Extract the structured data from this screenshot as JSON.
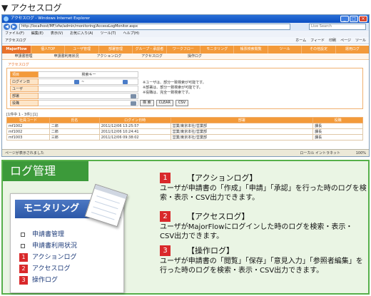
{
  "heading": "▼ アクセスログ",
  "browser": {
    "title": "アクセスログ - Windows Internet Explorer",
    "url": "http://localhost/MF/vfw/admin/monitoring/AccessLogMonitor.aspx",
    "search_placeholder": "Live Search",
    "menu": [
      "ファイル(F)",
      "編集(E)",
      "表示(V)",
      "お気に入り(A)",
      "ツール(T)",
      "ヘルプ(H)"
    ],
    "tab_label": "アクセスログ",
    "fav_right": [
      "ホーム",
      "フィード",
      "印刷",
      "ページ",
      "ツール"
    ],
    "logo": "MajorFlow",
    "nav_items": [
      "個人TOP",
      "ユーザ管理",
      "部署管理",
      "グループ・承認者",
      "ワークフロー",
      "モニタリング",
      "帳票検索閲覧",
      "ツール",
      "その他設定",
      "運用ログ"
    ],
    "sub_items": [
      "申請書管理",
      "申請書利用状況",
      "アクションログ",
      "アクセスログ",
      "操作ログ"
    ],
    "section_title": "アクセスログ",
    "form": {
      "head_label": "項目",
      "head_value": "検索キー",
      "rows": [
        {
          "label": "ログイン日",
          "value": "~"
        },
        {
          "label": "ユーザ",
          "value": ""
        },
        {
          "label": "部署",
          "value": ""
        },
        {
          "label": "役職",
          "value": ""
        }
      ],
      "notes": [
        "※ユーザは、部分一致検索が可能です。",
        "※部署は、部分一致検索が可能です。",
        "※役職は、完全一致検索です。"
      ],
      "search_button": "検 索",
      "clear_button": "CLEAR",
      "csv_button": "CSV"
    },
    "results_info": "[1件中 1 - 3件] [1]",
    "columns": [
      "社員コード",
      "氏名",
      "ログイン日時",
      "部署",
      "役職"
    ],
    "rows": [
      [
        "mf1002",
        "二郎",
        "2011/12/06 13:25:57",
        "営業/東京本社/営業部",
        "課長"
      ],
      [
        "mf1002",
        "二郎",
        "2011/12/06 10:24:41",
        "営業/東京本社/営業部",
        "課長"
      ],
      [
        "mf1003",
        "三郎",
        "2011/12/06 09:38:02",
        "営業/東京本社/営業部",
        "課長"
      ]
    ],
    "status_left": "ページが表示されました",
    "status_right": "ローカル イントラネット",
    "status_zoom": "100%"
  },
  "log_panel": {
    "tab_title": "ログ管理",
    "card_title": "モニタリング",
    "menu": [
      {
        "type": "bullet",
        "label": "申請書管理"
      },
      {
        "type": "bullet",
        "label": "申請書利用状況"
      },
      {
        "type": "num",
        "num": "1",
        "label": "アクションログ"
      },
      {
        "type": "num",
        "num": "2",
        "label": "アクセスログ"
      },
      {
        "type": "num",
        "num": "3",
        "label": "操作ログ"
      }
    ],
    "items": [
      {
        "num": "1",
        "title": "【アクションログ】",
        "body": "ユーザが申請書の「作成」「申請」「承認」を行った時のログを検索・表示・CSV出力できます。"
      },
      {
        "num": "2",
        "title": "【アクセスログ】",
        "body": "ユーザがMajorFlowにログインした時のログを検索・表示・CSV出力できます。"
      },
      {
        "num": "3",
        "title": "【操作ログ】",
        "body": "ユーザが申請書の「閲覧」「保存」「意見入力」「参照者編集」を行った時のログを検索・表示・CSV出力できます。"
      }
    ]
  }
}
